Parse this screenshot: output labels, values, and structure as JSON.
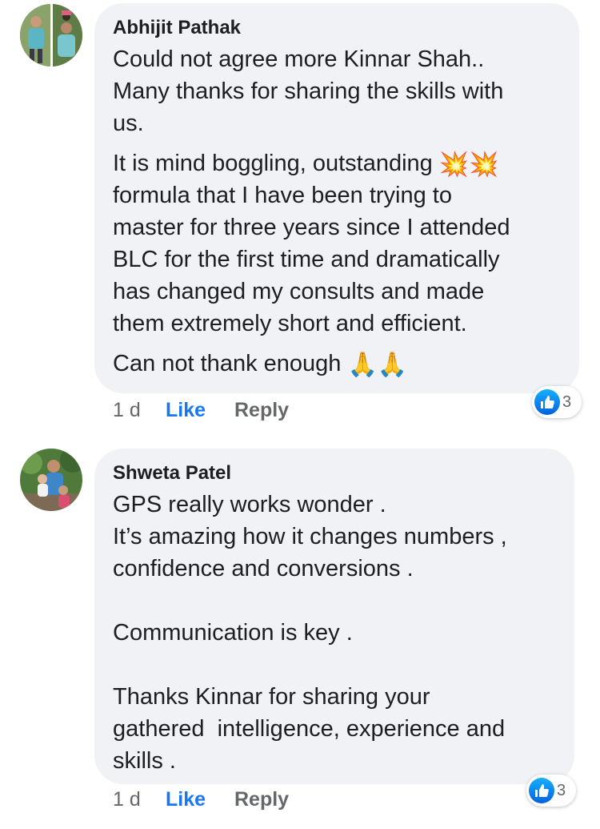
{
  "comments": [
    {
      "author": "Abhijit Pathak",
      "paragraphs": [
        "Could not agree more Kinnar Shah..\nMany thanks for sharing the skills with\nus.",
        "formula that I have been trying to\nmaster for three years since I attended\nBLC for the first time and dramatically\nhas changed my consults and made\nthem extremely short and efficient."
      ],
      "line_with_emoji_1": "It is mind boggling, outstanding ",
      "emoji_1": "💥💥",
      "line_with_emoji_2": "Can not thank enough ",
      "emoji_2": "🙏🙏",
      "time": "1 d",
      "like_label": "Like",
      "reply_label": "Reply",
      "reaction_count": "3",
      "reaction_icon": "like-icon"
    },
    {
      "author": "Shweta Patel",
      "paragraphs": [
        "GPS really works wonder .\nIt’s amazing how it changes numbers ,\nconfidence and conversions .\n\nCommunication is key .\n\nThanks Kinnar for sharing your\ngathered  intelligence, experience and\nskills ."
      ],
      "time": "1 d",
      "like_label": "Like",
      "reply_label": "Reply",
      "reaction_count": "3",
      "reaction_icon": "like-icon"
    }
  ],
  "colors": {
    "bubble": "#f0f2f5",
    "like_blue": "#1877f2",
    "meta_gray": "#65676b",
    "text": "#1c1e21"
  }
}
